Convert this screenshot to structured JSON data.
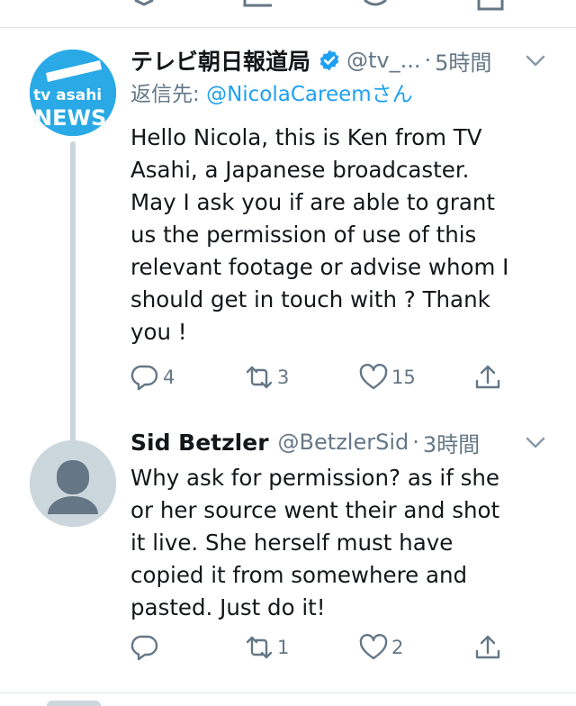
{
  "tweets": [
    {
      "name": "テレビ朝日報道局",
      "handle": "@tv_...",
      "time": "5時間",
      "reply_prefix": "返信先: ",
      "reply_mention": "@NicolaCareemさん",
      "avatar_text_top": "tv asahi",
      "avatar_text_bottom": "NEWS",
      "body": "Hello Nicola, this is Ken from TV\nAsahi, a Japanese broadcaster.\nMay I ask you if are able to grant\nus the permission of use of this\nrelevant footage or advise whom I\nshould get in touch with ? Thank\nyou !",
      "reply_count": "4",
      "retweet_count": "3",
      "like_count": "15"
    },
    {
      "name": "Sid Betzler",
      "handle": "@BetzlerSid",
      "time": "3時間",
      "body": "Why ask for permission? as if she\nor her source went their and shot\nit live. She herself must have\ncopied it from somewhere and\npasted. Just do it!",
      "reply_count": "",
      "retweet_count": "1",
      "like_count": "2"
    }
  ],
  "icons": {
    "reply": "reply-icon",
    "retweet": "retweet-icon",
    "like": "heart-icon",
    "share": "share-icon",
    "verified": "verified-badge-icon",
    "caret": "chevron-down-icon"
  },
  "colors": {
    "accent": "#1da1f2",
    "secondary_text": "#657786",
    "tv_asahi_blue": "#29a9e6"
  }
}
